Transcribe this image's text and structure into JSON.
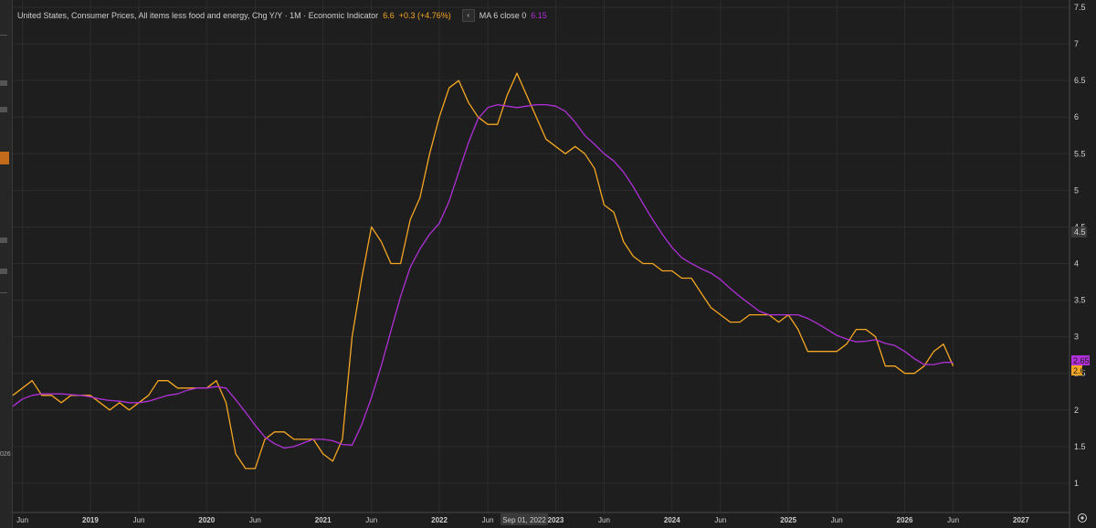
{
  "legend": {
    "series_title": "United States, Consumer Prices, All items less food and energy, Chg Y/Y · 1M · Economic Indicator",
    "last_value": "6.6",
    "change": "+0.3 (+4.76%)",
    "collapse_glyph": "‹",
    "ma_label": "MA 6 close 0",
    "ma_value": "6.15"
  },
  "left_fragment": "026",
  "crosshair_label": "Sep 01, 2022",
  "price_labels": {
    "hover": "4.5",
    "ma_last": "2.65",
    "series_last": "2.6"
  },
  "colors": {
    "background": "#1e1e1e",
    "grid": "#2c2c2c",
    "series": "#f5a623",
    "ma": "#b030d8",
    "axis_text": "#cfcfcf",
    "left_accent": "#c46a1b"
  },
  "icons": {
    "collapse": "chevron-left-icon",
    "settings": "settings-icon"
  },
  "chart_data": {
    "type": "line",
    "x_unit": "month",
    "x_range": [
      "2018-05",
      "2027-06"
    ],
    "ylim": [
      0.6,
      7.6
    ],
    "grid": true,
    "y_ticks": [
      1,
      1.5,
      2,
      2.5,
      3,
      3.5,
      4,
      4.5,
      5,
      5.5,
      6,
      6.5,
      7,
      7.5
    ],
    "y_tick_labels": [
      "1",
      "1.5",
      "2",
      "2.5",
      "3",
      "3.5",
      "4",
      "4.5",
      "5",
      "5.5",
      "6",
      "6.5",
      "7",
      "7.5"
    ],
    "x_ticks": [
      {
        "label": "Jun",
        "date": "2018-06",
        "year": false
      },
      {
        "label": "2019",
        "date": "2019-01",
        "year": true
      },
      {
        "label": "Jun",
        "date": "2019-06",
        "year": false
      },
      {
        "label": "2020",
        "date": "2020-01",
        "year": true
      },
      {
        "label": "Jun",
        "date": "2020-06",
        "year": false
      },
      {
        "label": "2021",
        "date": "2021-01",
        "year": true
      },
      {
        "label": "Jun",
        "date": "2021-06",
        "year": false
      },
      {
        "label": "2022",
        "date": "2022-01",
        "year": true
      },
      {
        "label": "Jun",
        "date": "2022-06",
        "year": false
      },
      {
        "label": "2023",
        "date": "2023-01",
        "year": true
      },
      {
        "label": "Jun",
        "date": "2023-06",
        "year": false
      },
      {
        "label": "2024",
        "date": "2024-01",
        "year": true
      },
      {
        "label": "Jun",
        "date": "2024-06",
        "year": false
      },
      {
        "label": "2025",
        "date": "2025-01",
        "year": true
      },
      {
        "label": "Jun",
        "date": "2025-06",
        "year": false
      },
      {
        "label": "2026",
        "date": "2026-01",
        "year": true
      },
      {
        "label": "Jun",
        "date": "2026-06",
        "year": false
      },
      {
        "label": "2027",
        "date": "2027-01",
        "year": true
      }
    ],
    "series": [
      {
        "name": "United States, Consumer Prices, All items less food and energy, Chg Y/Y",
        "color": "#f5a623",
        "x": [
          "2018-05",
          "2018-06",
          "2018-07",
          "2018-08",
          "2018-09",
          "2018-10",
          "2018-11",
          "2018-12",
          "2019-01",
          "2019-02",
          "2019-03",
          "2019-04",
          "2019-05",
          "2019-06",
          "2019-07",
          "2019-08",
          "2019-09",
          "2019-10",
          "2019-11",
          "2019-12",
          "2020-01",
          "2020-02",
          "2020-03",
          "2020-04",
          "2020-05",
          "2020-06",
          "2020-07",
          "2020-08",
          "2020-09",
          "2020-10",
          "2020-11",
          "2020-12",
          "2021-01",
          "2021-02",
          "2021-03",
          "2021-04",
          "2021-05",
          "2021-06",
          "2021-07",
          "2021-08",
          "2021-09",
          "2021-10",
          "2021-11",
          "2021-12",
          "2022-01",
          "2022-02",
          "2022-03",
          "2022-04",
          "2022-05",
          "2022-06",
          "2022-07",
          "2022-08",
          "2022-09",
          "2022-10",
          "2022-11",
          "2022-12",
          "2023-01",
          "2023-02",
          "2023-03",
          "2023-04",
          "2023-05",
          "2023-06",
          "2023-07",
          "2023-08",
          "2023-09",
          "2023-10",
          "2023-11",
          "2023-12",
          "2024-01",
          "2024-02",
          "2024-03",
          "2024-04",
          "2024-05",
          "2024-06",
          "2024-07",
          "2024-08",
          "2024-09",
          "2024-10",
          "2024-11",
          "2024-12",
          "2025-01",
          "2025-02",
          "2025-03",
          "2025-04",
          "2025-05",
          "2025-06",
          "2025-07",
          "2025-08",
          "2025-09",
          "2025-10",
          "2025-11",
          "2025-12",
          "2026-01",
          "2026-02",
          "2026-03",
          "2026-04",
          "2026-05",
          "2026-06"
        ],
        "y": [
          2.2,
          2.3,
          2.4,
          2.2,
          2.2,
          2.1,
          2.2,
          2.2,
          2.2,
          2.1,
          2.0,
          2.1,
          2.0,
          2.1,
          2.2,
          2.4,
          2.4,
          2.3,
          2.3,
          2.3,
          2.3,
          2.4,
          2.1,
          1.4,
          1.2,
          1.2,
          1.6,
          1.7,
          1.7,
          1.6,
          1.6,
          1.6,
          1.4,
          1.3,
          1.6,
          3.0,
          3.8,
          4.5,
          4.3,
          4.0,
          4.0,
          4.6,
          4.9,
          5.5,
          6.0,
          6.4,
          6.5,
          6.2,
          6.0,
          5.9,
          5.9,
          6.3,
          6.6,
          6.3,
          6.0,
          5.7,
          5.6,
          5.5,
          5.6,
          5.5,
          5.3,
          4.8,
          4.7,
          4.3,
          4.1,
          4.0,
          4.0,
          3.9,
          3.9,
          3.8,
          3.8,
          3.6,
          3.4,
          3.3,
          3.2,
          3.2,
          3.3,
          3.3,
          3.3,
          3.2,
          3.3,
          3.1,
          2.8,
          2.8,
          2.8,
          2.8,
          2.9,
          3.1,
          3.1,
          3.0,
          2.6,
          2.6,
          2.5,
          2.5,
          2.6,
          2.8,
          2.9,
          2.6
        ]
      },
      {
        "name": "MA 6 close 0",
        "color": "#b030d8",
        "x": [
          "2018-05",
          "2018-06",
          "2018-07",
          "2018-08",
          "2018-09",
          "2018-10",
          "2018-11",
          "2018-12",
          "2019-01",
          "2019-02",
          "2019-03",
          "2019-04",
          "2019-05",
          "2019-06",
          "2019-07",
          "2019-08",
          "2019-09",
          "2019-10",
          "2019-11",
          "2019-12",
          "2020-01",
          "2020-02",
          "2020-03",
          "2020-04",
          "2020-05",
          "2020-06",
          "2020-07",
          "2020-08",
          "2020-09",
          "2020-10",
          "2020-11",
          "2020-12",
          "2021-01",
          "2021-02",
          "2021-03",
          "2021-04",
          "2021-05",
          "2021-06",
          "2021-07",
          "2021-08",
          "2021-09",
          "2021-10",
          "2021-11",
          "2021-12",
          "2022-01",
          "2022-02",
          "2022-03",
          "2022-04",
          "2022-05",
          "2022-06",
          "2022-07",
          "2022-08",
          "2022-09",
          "2022-10",
          "2022-11",
          "2022-12",
          "2023-01",
          "2023-02",
          "2023-03",
          "2023-04",
          "2023-05",
          "2023-06",
          "2023-07",
          "2023-08",
          "2023-09",
          "2023-10",
          "2023-11",
          "2023-12",
          "2024-01",
          "2024-02",
          "2024-03",
          "2024-04",
          "2024-05",
          "2024-06",
          "2024-07",
          "2024-08",
          "2024-09",
          "2024-10",
          "2024-11",
          "2024-12",
          "2025-01",
          "2025-02",
          "2025-03",
          "2025-04",
          "2025-05",
          "2025-06",
          "2025-07",
          "2025-08",
          "2025-09",
          "2025-10",
          "2025-11",
          "2025-12",
          "2026-01",
          "2026-02",
          "2026-03",
          "2026-04",
          "2026-05",
          "2026-06"
        ],
        "y": [
          2.05,
          2.15,
          2.2,
          2.22,
          2.22,
          2.22,
          2.21,
          2.2,
          2.18,
          2.15,
          2.13,
          2.12,
          2.1,
          2.1,
          2.12,
          2.16,
          2.2,
          2.22,
          2.27,
          2.3,
          2.3,
          2.32,
          2.3,
          2.14,
          1.97,
          1.79,
          1.63,
          1.54,
          1.48,
          1.5,
          1.55,
          1.6,
          1.6,
          1.58,
          1.53,
          1.52,
          1.8,
          2.17,
          2.6,
          3.08,
          3.55,
          3.95,
          4.2,
          4.4,
          4.55,
          4.85,
          5.25,
          5.65,
          5.98,
          6.13,
          6.17,
          6.15,
          6.13,
          6.15,
          6.17,
          6.17,
          6.15,
          6.08,
          5.93,
          5.75,
          5.63,
          5.5,
          5.4,
          5.25,
          5.05,
          4.82,
          4.6,
          4.4,
          4.22,
          4.08,
          4.0,
          3.93,
          3.87,
          3.78,
          3.66,
          3.55,
          3.45,
          3.35,
          3.3,
          3.3,
          3.3,
          3.3,
          3.25,
          3.18,
          3.1,
          3.02,
          2.97,
          2.93,
          2.94,
          2.96,
          2.91,
          2.88,
          2.8,
          2.7,
          2.62,
          2.62,
          2.65,
          2.65
        ]
      }
    ]
  }
}
